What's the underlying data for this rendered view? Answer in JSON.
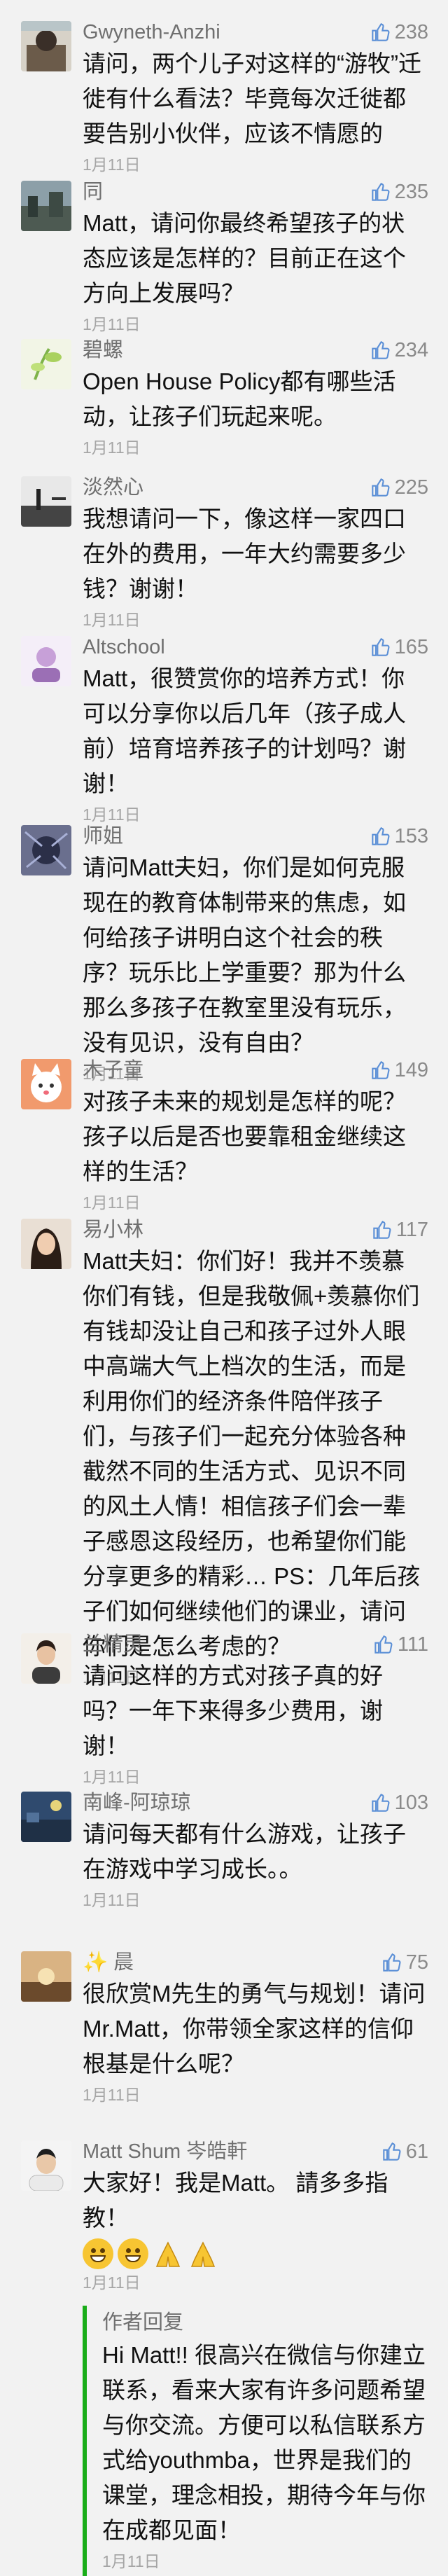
{
  "icons": {
    "like": "thumb-up-icon"
  },
  "colors": {
    "reply_bar": "#1aad19",
    "name": "#6f6f6f",
    "date": "#a5a5a5"
  },
  "comments": [
    {
      "name": "Gwyneth-Anzhi",
      "likes": "238",
      "text": "请问，两个儿子对这样的“游牧”迁徙有什么看法？毕竟每次迁徙都要告别小伙伴，应该不情愿的",
      "date": "1月11日"
    },
    {
      "name": "同",
      "likes": "235",
      "text": "Matt，请问你最终希望孩子的状态应该是怎样的？目前正在这个方向上发展吗？",
      "date": "1月11日"
    },
    {
      "name": "碧螺",
      "likes": "234",
      "text": "Open House Policy都有哪些活动，让孩子们玩起来呢。",
      "date": "1月11日"
    },
    {
      "name": "淡然心",
      "likes": "225",
      "text": "我想请问一下，像这样一家四口在外的费用，一年大约需要多少钱？谢谢！",
      "date": "1月11日"
    },
    {
      "name": "Altschool",
      "likes": "165",
      "text": "Matt，很赞赏你的培养方式！你可以分享你以后几年（孩子成人前）培育培养孩子的计划吗？谢谢！",
      "date": "1月11日"
    },
    {
      "name": "师姐",
      "likes": "153",
      "text": "请问Matt夫妇，你们是如何克服现在的教育体制带来的焦虑，如何给孩子讲明白这个社会的秩序？玩乐比上学重要？那为什么那么多孩子在教室里没有玩乐，没有见识，没有自由？",
      "date": "1月11日"
    },
    {
      "name": "木子童",
      "likes": "149",
      "text": "对孩子未来的规划是怎样的呢？孩子以后是否也要靠租金继续这样的生活？",
      "date": "1月11日"
    },
    {
      "name": "易小林",
      "likes": "117",
      "text": "Matt夫妇：你们好！我并不羡慕你们有钱，但是我敬佩+羡慕你们有钱却没让自己和孩子过外人眼中高端大气上档次的生活，而是利用你们的经济条件陪伴孩子们，与孩子们一起充分体验各种截然不同的生活方式、见识不同的风土人情！相信孩子们会一辈子感恩这段经历，也希望你们能分享更多的精彩… PS：几年后孩子们如何继续他们的课业，请问你们是怎么考虑的？",
      "date": "1月11日"
    },
    {
      "name": "兰精灵",
      "likes": "111",
      "text": "请问这样的方式对孩子真的好吗？一年下来得多少费用，谢谢！",
      "date": "1月11日"
    },
    {
      "name": "南峰-阿琼琼",
      "likes": "103",
      "text": "请问每天都有什么游戏，让孩子在游戏中学习成长。。",
      "date": "1月11日"
    },
    {
      "name": "✨ 晨",
      "likes": "75",
      "text": "很欣赏M先生的勇气与规划！请问Mr.Matt，你带领全家这样的信仰根基是什么呢？",
      "date": "1月11日"
    },
    {
      "name": "Matt Shum 岑皓軒",
      "likes": "61",
      "text": "大家好！我是Matt。 請多多指教！",
      "date": "1月11日",
      "reply": {
        "title": "作者回复",
        "text": "Hi Matt!! 很高兴在微信与你建立联系，看来大家有许多问题希望与你交流。方便可以私信联系方式给youthmba，世界是我们的课堂，理念相投，期待今年与你在成都见面！",
        "date": "1月11日"
      }
    }
  ]
}
